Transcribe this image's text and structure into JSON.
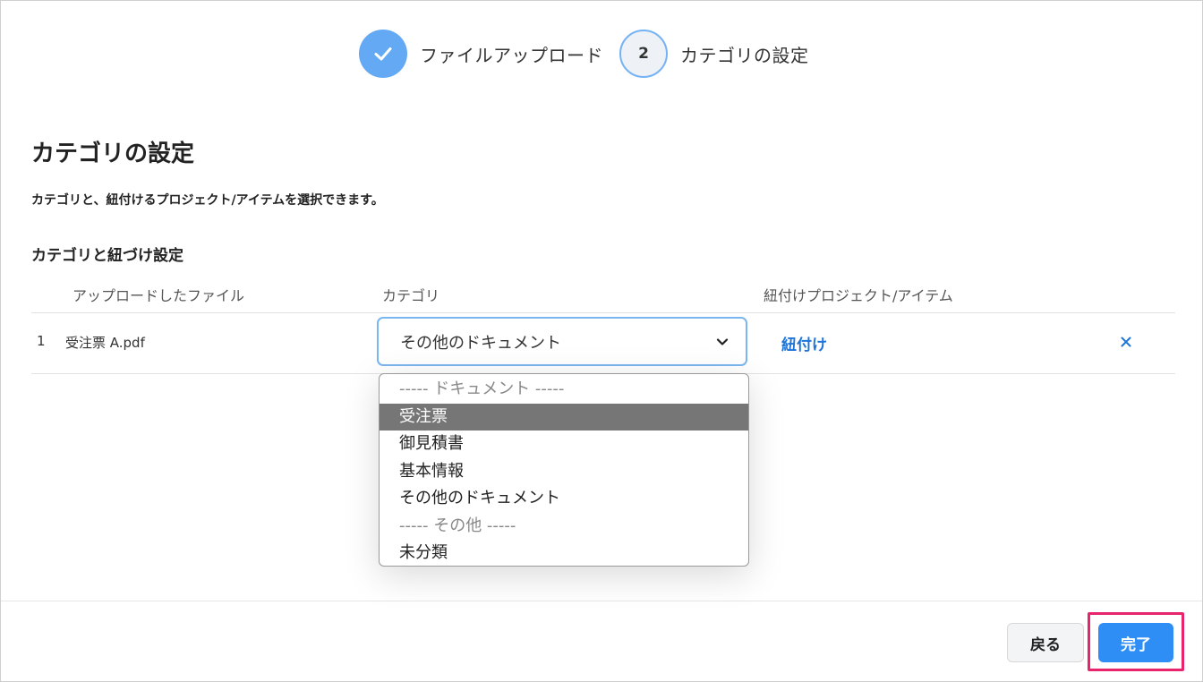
{
  "stepper": {
    "step1_label": "ファイルアップロード",
    "step2_number": "2",
    "step2_label": "カテゴリの設定"
  },
  "page": {
    "title": "カテゴリの設定",
    "description": "カテゴリと、紐付けるプロジェクト/アイテムを選択できます。",
    "section_title": "カテゴリと紐づけ設定"
  },
  "table": {
    "columns": [
      "アップロードしたファイル",
      "カテゴリ",
      "紐付けプロジェクト/アイテム"
    ],
    "rows": [
      {
        "index": "1",
        "file": "受注票 A.pdf",
        "category": "その他のドキュメント",
        "link_label": "紐付け",
        "remove_label": "×"
      }
    ]
  },
  "dropdown": {
    "options": [
      {
        "label": "----- ドキュメント -----",
        "kind": "group"
      },
      {
        "label": "受注票",
        "kind": "highlighted"
      },
      {
        "label": "御見積書",
        "kind": "option"
      },
      {
        "label": "基本情報",
        "kind": "option"
      },
      {
        "label": "その他のドキュメント",
        "kind": "option"
      },
      {
        "label": "----- その他 -----",
        "kind": "group"
      },
      {
        "label": "未分類",
        "kind": "option"
      }
    ]
  },
  "footer": {
    "back_label": "戻る",
    "done_label": "完了"
  },
  "colors": {
    "accent": "#2e8ef6",
    "link": "#1d74d9",
    "highlight_border": "#e8246d",
    "dropdown_highlight": "#767676"
  }
}
